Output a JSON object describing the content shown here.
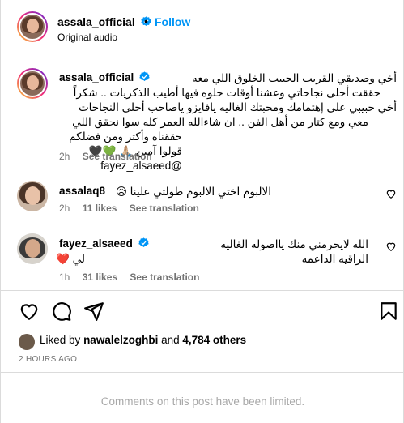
{
  "post_header": {
    "username": "assala_official",
    "separator": "•",
    "follow_label": "Follow",
    "audio_label": "Original audio"
  },
  "caption": {
    "username": "assala_official",
    "lines": [
      "أخي وصديقي القريب الحبيب الخلوق اللي معه",
      "حققت أحلى نجاحاتي وعشنا أوقات حلوه فيها أطيب الذكريات .. شكراً",
      "أخي حبيبي على إهتمامك ومحبتك الغاليه يافايزو ياصاحب أحلى النجاحات",
      "معي ومع كتار من أهل الفن .. ان شاءالله العمر كله سوا نحقق اللي",
      "حققناه وأكتر ومن فضلكم قولوا آمين 🙏🏼 💚🖤 @fayez_alsaeed"
    ],
    "time": "2h",
    "see_translation": "See translation"
  },
  "comments": [
    {
      "username": "assalaq8",
      "text": "الالبوم اختي الالبوم طولتي علينا 😥",
      "time": "2h",
      "likes": "11 likes",
      "see_translation": "See translation"
    },
    {
      "username": "fayez_alsaeed",
      "line1": "الله لايحرمني منك يااصوله الغاليه الراقيه الداعمه",
      "line2": "لي ❤️",
      "time": "1h",
      "likes": "31 likes",
      "see_translation": "See translation"
    }
  ],
  "likes_summary": {
    "prefix": "Liked by",
    "user": "nawalelzoghbi",
    "conj": "and",
    "others": "4,784 others"
  },
  "timestamp": "2 HOURS AGO",
  "comments_limited": "Comments on this post have been limited.",
  "colors": {
    "accent": "#0095f6",
    "verified": "#0095f6",
    "muted": "#737373",
    "heart_red": "#ed4956"
  },
  "icons": [
    "verified-badge-icon",
    "heart-icon",
    "comment-icon",
    "share-icon",
    "bookmark-icon"
  ]
}
